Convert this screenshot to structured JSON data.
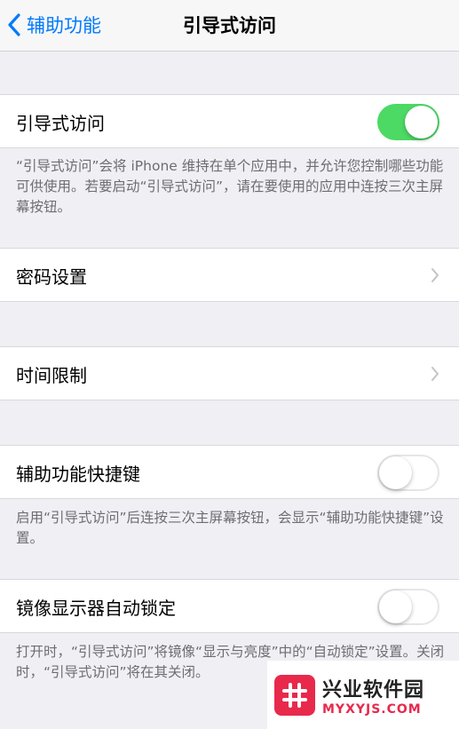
{
  "nav": {
    "back_label": "辅助功能",
    "title": "引导式访问"
  },
  "cells": {
    "guided_access": {
      "label": "引导式访问",
      "toggle_on": true
    },
    "passcode": {
      "label": "密码设置"
    },
    "time_limits": {
      "label": "时间限制"
    },
    "shortcut": {
      "label": "辅助功能快捷键",
      "toggle_on": false
    },
    "mirror_lock": {
      "label": "镜像显示器自动锁定",
      "toggle_on": false
    }
  },
  "footers": {
    "guided_access": "“引导式访问”会将 iPhone 维持在单个应用中，并允许您控制哪些功能可供使用。若要启动“引导式访问”，请在要使用的应用中连按三次主屏幕按钮。",
    "shortcut": "启用“引导式访问”后连按三次主屏幕按钮，会显示“辅助功能快捷键”设置。",
    "mirror_lock": "打开时，“引导式访问”将镜像“显示与亮度”中的“自动锁定”设置。关闭时，“引导式访问”将在其关闭。"
  },
  "watermark": {
    "name": "兴业软件园",
    "domain": "MYXYJS.COM"
  },
  "colors": {
    "accent": "#007aff",
    "toggle_on": "#4cd964",
    "background": "#efeff4",
    "watermark": "#e8294c"
  },
  "icons": [
    "chevron-left-icon",
    "chevron-right-icon",
    "hash-logo-icon"
  ]
}
